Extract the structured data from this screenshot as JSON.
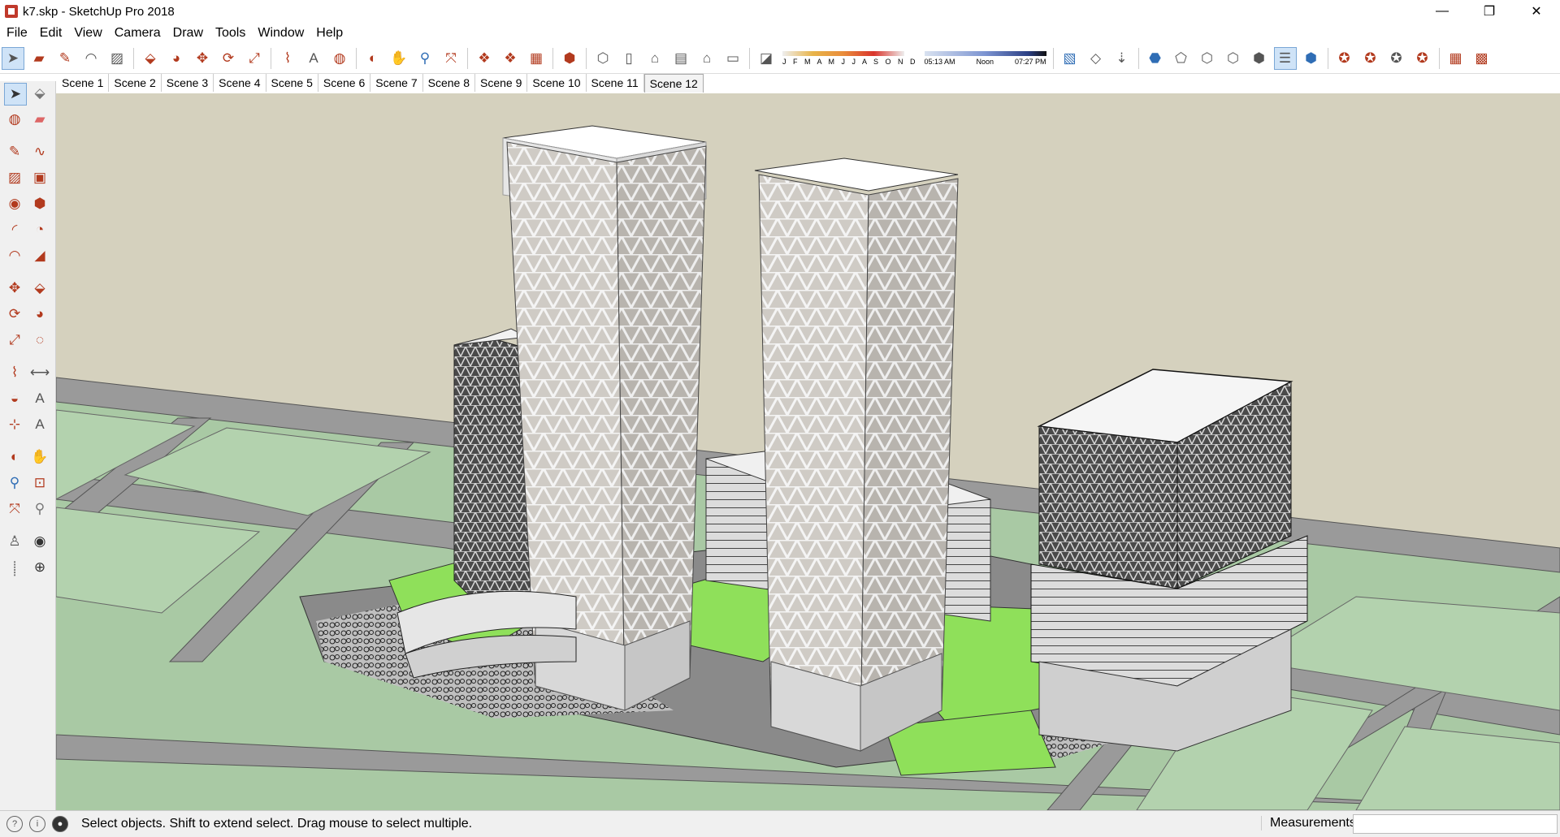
{
  "window": {
    "title": "k7.skp - SketchUp Pro 2018",
    "minimize": "—",
    "restore": "❐",
    "close": "✕"
  },
  "menu": [
    "File",
    "Edit",
    "View",
    "Camera",
    "Draw",
    "Tools",
    "Window",
    "Help"
  ],
  "shadows": {
    "months": "J F M A M J J A S O N D",
    "time_start": "05:13 AM",
    "time_mid": "Noon",
    "time_end": "07:27 PM"
  },
  "scenes": [
    "Scene 1",
    "Scene 2",
    "Scene 3",
    "Scene 4",
    "Scene 5",
    "Scene 6",
    "Scene 7",
    "Scene 8",
    "Scene 9",
    "Scene 10",
    "Scene 11",
    "Scene 12"
  ],
  "active_scene": "Scene 12",
  "status": {
    "message": "Select objects. Shift to extend select. Drag mouse to select multiple.",
    "measurements_label": "Measurements",
    "measurements_value": ""
  },
  "colors": {
    "sky": "#d5d1be",
    "ground": "#a9c9a4",
    "road": "#9a9a9a",
    "lawn": "#8fe05a",
    "building": "#c9c5c0"
  },
  "toolbar_icons": [
    "select",
    "eraser",
    "line",
    "arc",
    "rectangle",
    "push-pull",
    "follow-me",
    "move",
    "rotate",
    "scale",
    "tape",
    "text",
    "paint",
    "orbit",
    "pan",
    "zoom",
    "zoom-extents",
    "components",
    "groups",
    "styles",
    "warehouse",
    "iso-view",
    "top-view",
    "front-view",
    "right-view",
    "back-view",
    "left-view",
    "section-plane",
    "shadows"
  ],
  "left_tool_icons": [
    "select",
    "component",
    "paint-bucket",
    "eraser",
    "line",
    "freehand",
    "rectangle",
    "rotated-rectangle",
    "circle",
    "polygon",
    "arc",
    "pie",
    "two-point-arc",
    "three-point-arc",
    "move",
    "push-pull",
    "rotate",
    "follow-me",
    "scale",
    "offset",
    "tape-measure",
    "dimension",
    "protractor",
    "text",
    "axes",
    "3d-text",
    "orbit",
    "pan",
    "zoom",
    "zoom-window",
    "zoom-extents",
    "previous",
    "position-camera",
    "look-around",
    "walk",
    "section-plane"
  ]
}
